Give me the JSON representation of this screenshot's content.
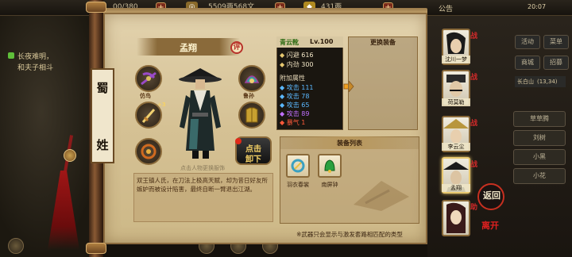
{
  "topbar": {
    "stamina": "00/380",
    "coins": "5509两568文",
    "gold": "431两",
    "notice": "公告",
    "time": "20:07"
  },
  "quests": [
    "长夜难明，",
    "和夫子相斗"
  ],
  "faction": [
    "蜀",
    "",
    "",
    "姓"
  ],
  "hero": {
    "name": "孟翔",
    "eval_badge": "评",
    "caption": "点击人物更换服饰",
    "description": "双王镇人氏，在刀法上极高天赋，却为昔日好友所嫉妒而被设计陷害，最终自断一臂退出江湖。"
  },
  "slots": {
    "left": [
      {
        "tag": "仿鸟",
        "icon": "crossbow-icon",
        "color": "#6a2a8a"
      },
      {
        "tag": "+3",
        "icon": "sword-icon",
        "color": "#d8a040"
      },
      {
        "tag": "",
        "icon": "bracelet-icon",
        "color": "#c06020"
      }
    ],
    "right": [
      {
        "tag": "鲁孙",
        "icon": "helmet-icon",
        "color": "#3a8a8a"
      },
      {
        "tag": "",
        "icon": "armor-icon",
        "color": "#c89a30"
      }
    ]
  },
  "change_button": {
    "line1": "点击",
    "line2": "卸下"
  },
  "stats": {
    "header": "青云靴",
    "level": "Lv.100",
    "base": [
      {
        "key": "闪避",
        "value": "616"
      },
      {
        "key": "内劲",
        "value": "300"
      }
    ],
    "extra_label": "附加属性",
    "extra": [
      {
        "key": "攻击",
        "value": "111",
        "color": "#5bb8ff"
      },
      {
        "key": "攻击",
        "value": "78",
        "color": "#5bb8ff"
      },
      {
        "key": "攻击",
        "value": "65",
        "color": "#5bb8ff"
      },
      {
        "key": "攻击",
        "value": "89",
        "color": "#c070ff"
      },
      {
        "key": "暴气",
        "value": "1",
        "color": "#ff5a3a"
      }
    ]
  },
  "change_panel_title": "更换装备",
  "equipment_list": {
    "title": "装备列表",
    "items": [
      {
        "label": "羽衣春裳",
        "color": "#3aa0c0"
      },
      {
        "label": "南屏钟",
        "color": "#2aa040"
      }
    ],
    "note": "※武器只会显示与激发套路相匹配的类型"
  },
  "right_buttons": [
    "活动",
    "菜单",
    "商城",
    "招募"
  ],
  "location": "长白山",
  "location_coords": "(13,34)",
  "party": [
    {
      "name": "沈川一梦",
      "battle": "战"
    },
    {
      "name": "荷莫勒",
      "battle": "战"
    },
    {
      "name": "李云尘",
      "battle": "战"
    },
    {
      "name": "孟翔",
      "battle": "战"
    },
    {
      "name": "",
      "battle": "助"
    }
  ],
  "list_buttons": [
    "草草腾",
    "刘树",
    "小黑",
    "小花"
  ],
  "return_label": "返回",
  "seal_label": "离开"
}
